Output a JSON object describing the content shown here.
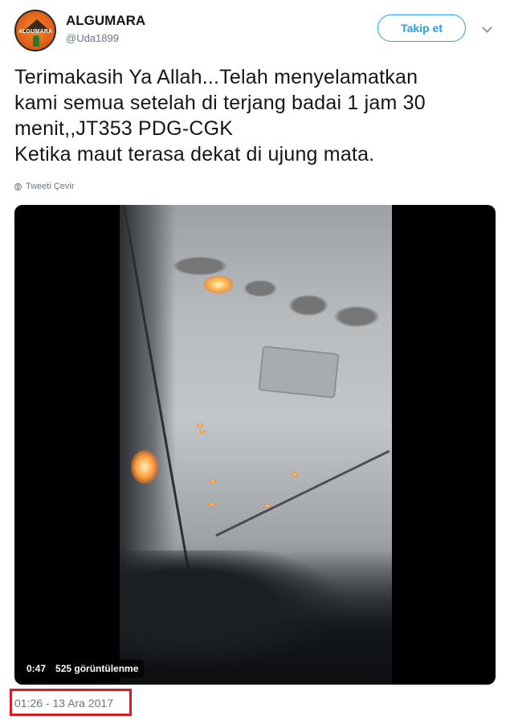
{
  "header": {
    "avatar_text": "ALGUMARA",
    "display_name": "ALGUMARA",
    "handle": "@Uda1899",
    "follow_label": "Takip et"
  },
  "tweet": {
    "lines": [
      "Terimakasih Ya Allah...Telah menyelamatkan",
      "kami semua setelah di terjang badai 1 jam 30",
      "menit,,JT353 PDG-CGK",
      "Ketika maut terasa dekat di ujung mata."
    ],
    "translate_label": "Tweeti Çevir"
  },
  "video": {
    "duration": "0:47",
    "views": "525 görüntülenme"
  },
  "timestamp": "01:26 - 13 Ara 2017",
  "colors": {
    "accent": "#1da1f2",
    "highlight_box": "#e0191f",
    "muted_text": "#657786"
  },
  "icons": {
    "menu": "chevron-down-icon",
    "translate": "globe-icon"
  }
}
